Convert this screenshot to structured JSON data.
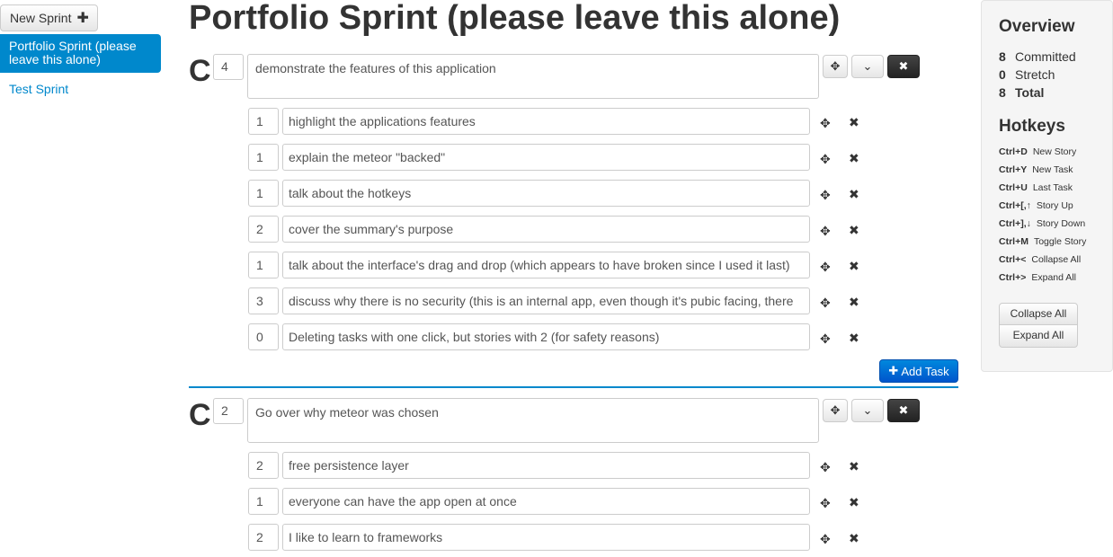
{
  "sidebar": {
    "new_sprint_label": "New Sprint",
    "sprints": [
      {
        "label": "Portfolio Sprint (please leave this alone)",
        "active": true
      },
      {
        "label": "Test Sprint",
        "active": false
      }
    ]
  },
  "page_title": "Portfolio Sprint (please leave this alone)",
  "stories": [
    {
      "status": "C",
      "points": "4",
      "description": "demonstrate the features of this application",
      "tasks": [
        {
          "points": "1",
          "description": "highlight the applications features"
        },
        {
          "points": "1",
          "description": "explain the meteor \"backed\""
        },
        {
          "points": "1",
          "description": "talk about the hotkeys"
        },
        {
          "points": "2",
          "description": "cover the summary's purpose"
        },
        {
          "points": "1",
          "description": "talk about the interface's drag and drop (which appears to have broken since I used it last)"
        },
        {
          "points": "3",
          "description": "discuss why there is no security (this is an internal app, even though it's pubic facing, there"
        },
        {
          "points": "0",
          "description": "Deleting tasks with one click, but stories with 2 (for safety reasons)"
        }
      ],
      "add_task_label": "Add Task"
    },
    {
      "status": "C",
      "points": "2",
      "description": "Go over why meteor was chosen",
      "tasks": [
        {
          "points": "2",
          "description": "free persistence layer"
        },
        {
          "points": "1",
          "description": "everyone can have the app open at once"
        },
        {
          "points": "2",
          "description": "I like to learn to frameworks"
        }
      ]
    }
  ],
  "overview": {
    "heading": "Overview",
    "stats": [
      {
        "value": "8",
        "label": "Committed",
        "bold": false
      },
      {
        "value": "0",
        "label": "Stretch",
        "bold": false
      },
      {
        "value": "8",
        "label": "Total",
        "bold": true
      }
    ]
  },
  "hotkeys": {
    "heading": "Hotkeys",
    "items": [
      {
        "key": "Ctrl+D",
        "action": "New Story"
      },
      {
        "key": "Ctrl+Y",
        "action": "New Task"
      },
      {
        "key": "Ctrl+U",
        "action": "Last Task"
      },
      {
        "key": "Ctrl+[,↑",
        "action": "Story Up"
      },
      {
        "key": "Ctrl+],↓",
        "action": "Story Down"
      },
      {
        "key": "Ctrl+M",
        "action": "Toggle Story"
      },
      {
        "key": "Ctrl+<",
        "action": "Collapse All"
      },
      {
        "key": "Ctrl+>",
        "action": "Expand All"
      }
    ],
    "collapse_all_label": "Collapse All",
    "expand_all_label": "Expand All"
  },
  "icons": {
    "plus": "plus-icon",
    "move": "move-icon",
    "chevron": "chevron-down-icon",
    "remove": "remove-icon"
  }
}
